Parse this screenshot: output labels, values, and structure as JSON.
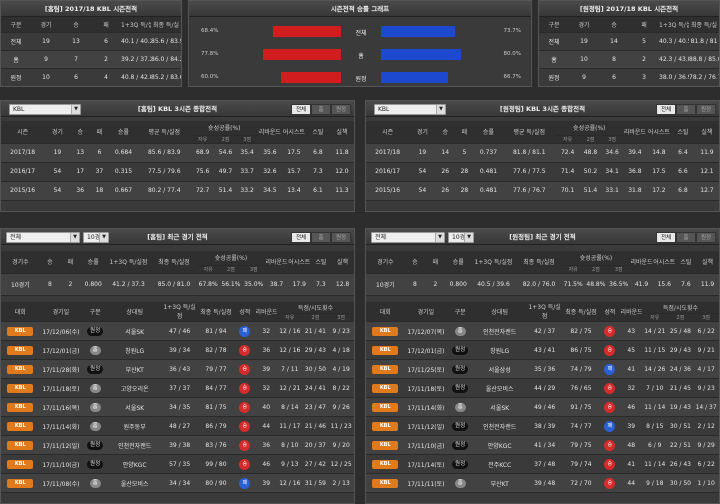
{
  "home_season": {
    "title": "[홈팀] 2017/18 KBL 시즌전적",
    "headers": [
      "구분",
      "경기",
      "승",
      "패",
      "1+3Q 득/실",
      "최종 득/실"
    ],
    "rows": [
      [
        "전체",
        "19",
        "13",
        "6",
        "40.1 / 40.2",
        "85.6 / 83.9"
      ],
      [
        "홈",
        "9",
        "7",
        "2",
        "39.2 / 37.2",
        "86.0 / 84.2"
      ],
      [
        "원정",
        "10",
        "6",
        "4",
        "40.8 / 42.8",
        "85.2 / 83.6"
      ]
    ]
  },
  "away_season": {
    "title": "[원정팀] 2017/18 KBL 시즌전적",
    "headers": [
      "구분",
      "경기",
      "승",
      "패",
      "1+3Q 득/실",
      "최종 득/실"
    ],
    "rows": [
      [
        "전체",
        "19",
        "14",
        "5",
        "40.3 / 40.5",
        "81.8 / 81"
      ],
      [
        "홈",
        "10",
        "8",
        "2",
        "42.3 / 43.8",
        "88.8 / 85.0"
      ],
      [
        "원정",
        "9",
        "6",
        "3",
        "38.0 / 36.9",
        "78.2 / 76.7"
      ]
    ]
  },
  "win_graph": {
    "title": "시즌전적 승률 그래프",
    "rows": [
      {
        "label": "전체",
        "home": 68.4,
        "away": 73.7,
        "home_text": "68.4%",
        "away_text": "73.7%"
      },
      {
        "label": "홈",
        "home": 77.8,
        "away": 80.0,
        "home_text": "77.8%",
        "away_text": "80.0%"
      },
      {
        "label": "원정",
        "home": 60.0,
        "away": 66.7,
        "home_text": "60.0%",
        "away_text": "66.7%"
      }
    ],
    "home_color": "#d11d1d",
    "away_color": "#1d49d1"
  },
  "home_3season": {
    "league": "KBL",
    "title": "[홈팀] KBL 3시즌 종합전적",
    "tabs": [
      "전체",
      "홈",
      "원정"
    ],
    "h1": [
      "시즌",
      "경기",
      "승",
      "패",
      "승률",
      "평균 득/실점",
      "슛성공률(%)",
      "리바운드",
      "어시스트",
      "스틸",
      "실책"
    ],
    "h2": [
      "자유",
      "2점",
      "3점"
    ],
    "rows": [
      [
        "2017/18",
        "19",
        "13",
        "6",
        "0.684",
        "85.6 / 83.9",
        "68.9",
        "54.6",
        "35.4",
        "35.6",
        "17.5",
        "6.8",
        "11.8"
      ],
      [
        "2016/17",
        "54",
        "17",
        "37",
        "0.315",
        "77.5 / 79.6",
        "75.6",
        "49.7",
        "33.7",
        "32.6",
        "15.7",
        "7.3",
        "12.0"
      ],
      [
        "2015/16",
        "54",
        "36",
        "18",
        "0.667",
        "80.2 / 77.4",
        "72.7",
        "51.4",
        "33.2",
        "34.5",
        "13.4",
        "6.1",
        "11.3"
      ]
    ]
  },
  "away_3season": {
    "league": "KBL",
    "title": "[원정팀] KBL 3시즌 종합전적",
    "tabs": [
      "전체",
      "홈",
      "원정"
    ],
    "h1": [
      "시즌",
      "경기",
      "승",
      "패",
      "승률",
      "평균 득/실점",
      "슛성공률(%)",
      "리바운드",
      "어시스트",
      "스틸",
      "실책"
    ],
    "h2": [
      "자유",
      "2점",
      "3점"
    ],
    "rows": [
      [
        "2017/18",
        "19",
        "14",
        "5",
        "0.737",
        "81.8 / 81.1",
        "72.4",
        "48.8",
        "34.6",
        "39.4",
        "14.8",
        "6.4",
        "11.9"
      ],
      [
        "2016/17",
        "54",
        "26",
        "28",
        "0.481",
        "77.6 / 77.5",
        "71.4",
        "50.2",
        "34.1",
        "36.8",
        "17.5",
        "6.6",
        "12.1"
      ],
      [
        "2015/16",
        "54",
        "26",
        "28",
        "0.481",
        "77.6 / 76.7",
        "70.1",
        "51.4",
        "33.1",
        "31.8",
        "17.2",
        "6.8",
        "12.7"
      ]
    ]
  },
  "home_recent": {
    "filter": "전체",
    "count": "10경기",
    "title": "[홈팀] 최근 경기 전적",
    "tabs": [
      "전체",
      "홈",
      "원정"
    ],
    "sum_h1": [
      "경기수",
      "승",
      "패",
      "승률",
      "1+3Q 득/실점",
      "최종 득/실점",
      "슛성공률(%)",
      "리바운드",
      "어시스트",
      "스틸",
      "실책"
    ],
    "sum_h2": [
      "자유",
      "2점",
      "3점"
    ],
    "sum": [
      "10경기",
      "8",
      "2",
      "0.800",
      "41.2 / 37.3",
      "85.0 / 81.0",
      "67.8%",
      "56.1%",
      "35.0%",
      "38.7",
      "17.9",
      "7.3",
      "12.8"
    ],
    "h": [
      "대회",
      "경기일",
      "구분",
      "상대팀",
      "1+3Q 득/실점",
      "최종 득/실점",
      "성적",
      "리바운드",
      "득점/시도횟수"
    ],
    "h2": [
      "자유",
      "2점",
      "3점"
    ],
    "rows": [
      [
        "KBL",
        "17/12/06(수)",
        "원정",
        "서울SK",
        "47 / 46",
        "81 / 94",
        "패",
        "l",
        "32",
        "12 / 16",
        "21 / 41",
        "9 / 23"
      ],
      [
        "KBL",
        "17/12/01(금)",
        "홈",
        "창원LG",
        "39 / 34",
        "82 / 78",
        "승",
        "w",
        "36",
        "12 / 16",
        "29 / 43",
        "4 / 18"
      ],
      [
        "KBL",
        "17/11/28(화)",
        "원정",
        "부산KT",
        "36 / 43",
        "79 / 77",
        "승",
        "w",
        "39",
        "7 / 11",
        "30 / 50",
        "4 / 19"
      ],
      [
        "KBL",
        "17/11/18(토)",
        "홈",
        "고양오리온",
        "37 / 37",
        "84 / 77",
        "승",
        "w",
        "32",
        "12 / 21",
        "24 / 41",
        "8 / 22"
      ],
      [
        "KBL",
        "17/11/16(목)",
        "홈",
        "서울SK",
        "34 / 35",
        "81 / 75",
        "승",
        "w",
        "40",
        "8 / 14",
        "23 / 47",
        "9 / 26"
      ],
      [
        "KBL",
        "17/11/14(화)",
        "홈",
        "원주동부",
        "48 / 27",
        "86 / 79",
        "승",
        "w",
        "44",
        "11 / 17",
        "21 / 46",
        "11 / 23"
      ],
      [
        "KBL",
        "17/11/12(일)",
        "원정",
        "인천전자랜드",
        "39 / 38",
        "83 / 76",
        "승",
        "w",
        "36",
        "8 / 10",
        "20 / 37",
        "9 / 20"
      ],
      [
        "KBL",
        "17/11/10(금)",
        "원정",
        "안양KGC",
        "57 / 35",
        "99 / 80",
        "승",
        "w",
        "46",
        "9 / 13",
        "27 / 42",
        "12 / 25"
      ],
      [
        "KBL",
        "17/11/08(수)",
        "홈",
        "울산모비스",
        "34 / 34",
        "80 / 90",
        "패",
        "l",
        "39",
        "12 / 16",
        "31 / 59",
        "2 / 13"
      ]
    ]
  },
  "away_recent": {
    "filter": "전체",
    "count": "10경기",
    "title": "[원정팀] 최근 경기 전적",
    "tabs": [
      "전체",
      "홈",
      "원정"
    ],
    "sum_h1": [
      "경기수",
      "승",
      "패",
      "승률",
      "1+3Q 득/실점",
      "최종 득/실점",
      "슛성공률(%)",
      "리바운드",
      "어시스트",
      "스틸",
      "실책"
    ],
    "sum_h2": [
      "자유",
      "2점",
      "3점"
    ],
    "sum": [
      "10경기",
      "8",
      "2",
      "0.800",
      "40.5 / 39.6",
      "82.0 / 76.0",
      "71.5%",
      "48.8%",
      "36.5%",
      "41.9",
      "15.6",
      "7.6",
      "11.9"
    ],
    "h": [
      "대회",
      "경기일",
      "구분",
      "상대팀",
      "1+3Q 득/실점",
      "최종 득/실점",
      "성적",
      "리바운드",
      "득점/시도횟수"
    ],
    "h2": [
      "자유",
      "2점",
      "3점"
    ],
    "rows": [
      [
        "KBL",
        "17/12/07(목)",
        "홈",
        "인천전자랜드",
        "42 / 37",
        "82 / 75",
        "승",
        "w",
        "43",
        "14 / 21",
        "25 / 48",
        "6 / 22"
      ],
      [
        "KBL",
        "17/12/01(금)",
        "원정",
        "창원LG",
        "43 / 41",
        "86 / 75",
        "승",
        "w",
        "45",
        "11 / 15",
        "29 / 43",
        "9 / 21"
      ],
      [
        "KBL",
        "17/11/25(토)",
        "원정",
        "서울삼성",
        "35 / 36",
        "74 / 79",
        "패",
        "l",
        "41",
        "14 / 26",
        "24 / 36",
        "4 / 17"
      ],
      [
        "KBL",
        "17/11/18(토)",
        "원정",
        "울산모비스",
        "44 / 29",
        "76 / 65",
        "승",
        "w",
        "32",
        "7 / 10",
        "21 / 45",
        "9 / 23"
      ],
      [
        "KBL",
        "17/11/14(화)",
        "홈",
        "서울SK",
        "49 / 46",
        "91 / 75",
        "승",
        "w",
        "46",
        "11 / 14",
        "19 / 43",
        "14 / 37"
      ],
      [
        "KBL",
        "17/11/12(일)",
        "원정",
        "인천전자랜드",
        "38 / 39",
        "74 / 77",
        "패",
        "l",
        "39",
        "8 / 15",
        "30 / 51",
        "2 / 12"
      ],
      [
        "KBL",
        "17/11/10(금)",
        "원정",
        "안양KGC",
        "41 / 34",
        "79 / 75",
        "승",
        "w",
        "48",
        "6 / 9",
        "22 / 51",
        "9 / 29"
      ],
      [
        "KBL",
        "17/11/14(토)",
        "원정",
        "전주KCC",
        "37 / 48",
        "79 / 74",
        "승",
        "w",
        "41",
        "11 / 14",
        "26 / 43",
        "6 / 22"
      ],
      [
        "KBL",
        "17/11/11(토)",
        "홈",
        "부산KT",
        "39 / 48",
        "72 / 70",
        "승",
        "w",
        "44",
        "9 / 18",
        "30 / 50",
        "1 / 10"
      ]
    ]
  }
}
